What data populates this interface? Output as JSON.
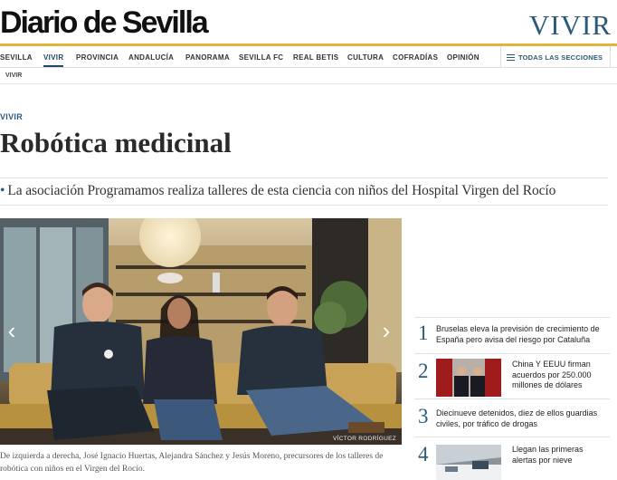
{
  "header": {
    "logo": "Diario de Sevilla",
    "section": "VIVIR"
  },
  "nav": {
    "items": [
      "SEVILLA",
      "VIVIR",
      "PROVINCIA",
      "ANDALUCÍA",
      "PANORAMA",
      "SEVILLA FC",
      "REAL BETIS",
      "CULTURA",
      "COFRADÍAS",
      "OPINIÓN"
    ],
    "active": "VIVIR",
    "all_sections": "TODAS LAS SECCIONES",
    "subnav": "VIVIR"
  },
  "article": {
    "kicker": "VIVIR",
    "headline": "Robótica medicinal",
    "summary": "La asociación Programamos realiza talleres de esta ciencia con niños del Hospital Virgen del Rocío",
    "photo_credit": "VÍCTOR RODRÍGUEZ",
    "caption": "De izquierda a derecha, José Ignacio Huertas, Alejandra Sánchez y Jesús Moreno, precursores de los talleres de robótica con niños en el Virgen del Rocío."
  },
  "ranking": [
    {
      "num": "1",
      "text": "Bruselas eleva la previsión de crecimiento de España pero avisa del riesgo por Cataluña",
      "has_thumb": false
    },
    {
      "num": "2",
      "text": "China Y EEUU firman acuerdos por 250.000 millones de dólares",
      "has_thumb": true
    },
    {
      "num": "3",
      "text": "Diecinueve detenidos, diez de ellos guardias civiles, por tráfico de drogas",
      "has_thumb": false
    },
    {
      "num": "4",
      "text": "Llegan las primeras alertas por nieve",
      "has_thumb": true
    }
  ],
  "colors": {
    "accent": "#2a5a7a",
    "gold": "#e2b53a"
  }
}
